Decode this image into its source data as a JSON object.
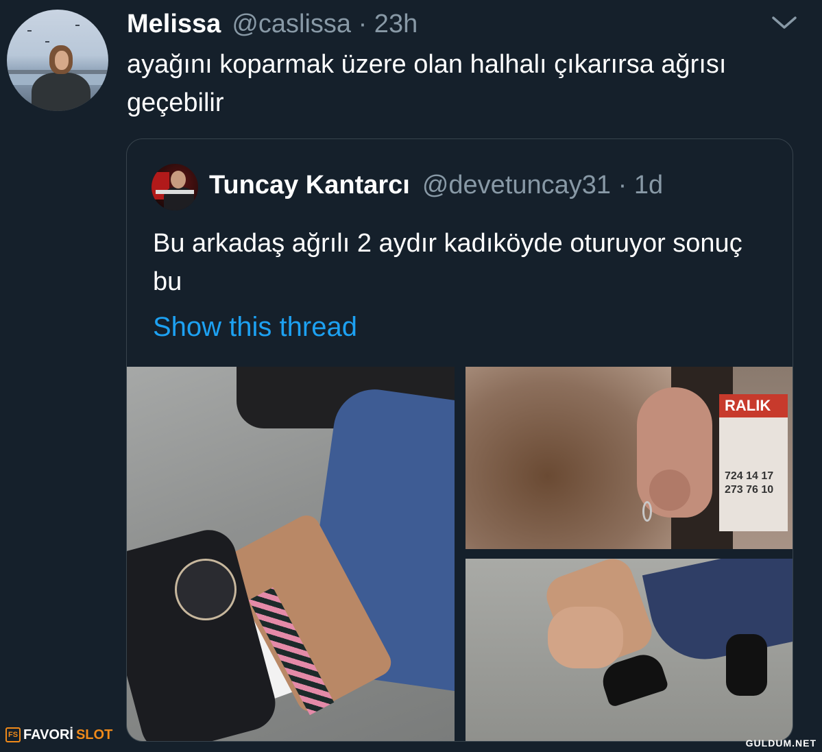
{
  "tweet": {
    "author_name": "Melissa",
    "author_meta": "@caslissa · 23h",
    "text": "ayağını koparmak üzere olan halhalı çıkarırsa ağrısı geçebilir",
    "avatar_icon": "profile-avatar",
    "menu_icon": "chevron-down-icon"
  },
  "quoted_tweet": {
    "author_name": "Tuncay Kantarcı",
    "author_meta": "@devetuncay31 · 1d",
    "text": "Bu arkadaş ağrılı 2 aydır kadıköyde oturuyor sonuç bu",
    "show_thread": "Show this thread",
    "images": [
      "photo-ankle-bracelet",
      "photo-ear-earring",
      "photo-wrist-bracelet"
    ],
    "sign_text": "RALIK",
    "sign_numbers": [
      "724 14 17",
      "273 76 10"
    ]
  },
  "watermarks": {
    "left_box": "FS",
    "left_a": "FAVORİ",
    "left_b": "SLOT",
    "right": "GULDUM.NET"
  },
  "colors": {
    "background": "#15202b",
    "secondary_text": "#8899a6",
    "link": "#1da1f2",
    "border": "#38444d"
  }
}
